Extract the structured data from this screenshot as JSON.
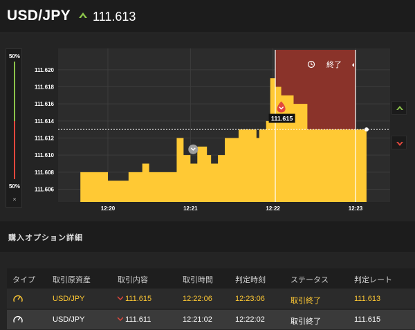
{
  "header": {
    "pair": "USD/JPY",
    "price": "111.613",
    "direction_icon": "up-arrow-icon",
    "up_color": "#8bc34a"
  },
  "gauge": {
    "top_label": "50%",
    "bottom_label": "50%",
    "close_label": "×",
    "up_color": "#8bc34a",
    "down_color": "#e2483d"
  },
  "chart": {
    "y_ticks": [
      "111.620",
      "111.618",
      "111.616",
      "111.614",
      "111.612",
      "111.610",
      "111.608",
      "111.606"
    ],
    "x_ticks": [
      "12:20",
      "12:21",
      "12:22",
      "12:23"
    ],
    "end_label": "終了",
    "marker_label": "111.615",
    "fill_color": "#ffc934",
    "expired_zone_color": "#8a332a"
  },
  "chart_data": {
    "type": "area",
    "x": [
      "12:19:40",
      "12:19:55",
      "12:20:00",
      "12:20:10",
      "12:20:15",
      "12:20:20",
      "12:20:25",
      "12:20:30",
      "12:20:40",
      "12:20:45",
      "12:20:50",
      "12:20:55",
      "12:20:58",
      "12:21:00",
      "12:21:05",
      "12:21:10",
      "12:21:12",
      "12:21:15",
      "12:21:20",
      "12:21:25",
      "12:21:35",
      "12:21:40",
      "12:21:45",
      "12:21:48",
      "12:21:50",
      "12:21:55",
      "12:21:58",
      "12:22:02",
      "12:22:06",
      "12:22:10",
      "12:22:15",
      "12:22:20",
      "12:22:25",
      "12:22:35",
      "12:22:45",
      "12:22:55",
      "12:23:05",
      "12:23:08"
    ],
    "values": [
      111.608,
      111.608,
      111.607,
      111.607,
      111.608,
      111.608,
      111.609,
      111.608,
      111.608,
      111.608,
      111.612,
      111.61,
      111.61,
      111.609,
      111.611,
      111.611,
      111.61,
      111.609,
      111.61,
      111.612,
      111.613,
      111.613,
      111.613,
      111.612,
      111.613,
      111.614,
      111.619,
      111.618,
      111.617,
      111.617,
      111.616,
      111.616,
      111.613,
      111.613,
      111.613,
      111.613,
      111.613,
      111.612
    ],
    "ylim": [
      111.6045,
      111.6225
    ],
    "current_rate": 111.613,
    "purchase_marker": {
      "x": "12:22:06",
      "value": 111.615
    },
    "grid": true
  },
  "section": {
    "title": "購入オプション詳細"
  },
  "table": {
    "headers": [
      "タイプ",
      "取引原資産",
      "取引内容",
      "取引時間",
      "判定時刻",
      "ステータス",
      "判定レート"
    ],
    "rows": [
      {
        "type_icon": "timer-icon",
        "asset": "USD/JPY",
        "content": "111.615",
        "direction": "down",
        "time": "12:22:06",
        "judge_time": "12:23:06",
        "status": "取引終了",
        "rate": "111.613"
      },
      {
        "type_icon": "timer-icon",
        "asset": "USD/JPY",
        "content": "111.611",
        "direction": "down",
        "time": "12:21:02",
        "judge_time": "12:22:02",
        "status": "取引終了",
        "rate": "111.615"
      }
    ]
  }
}
